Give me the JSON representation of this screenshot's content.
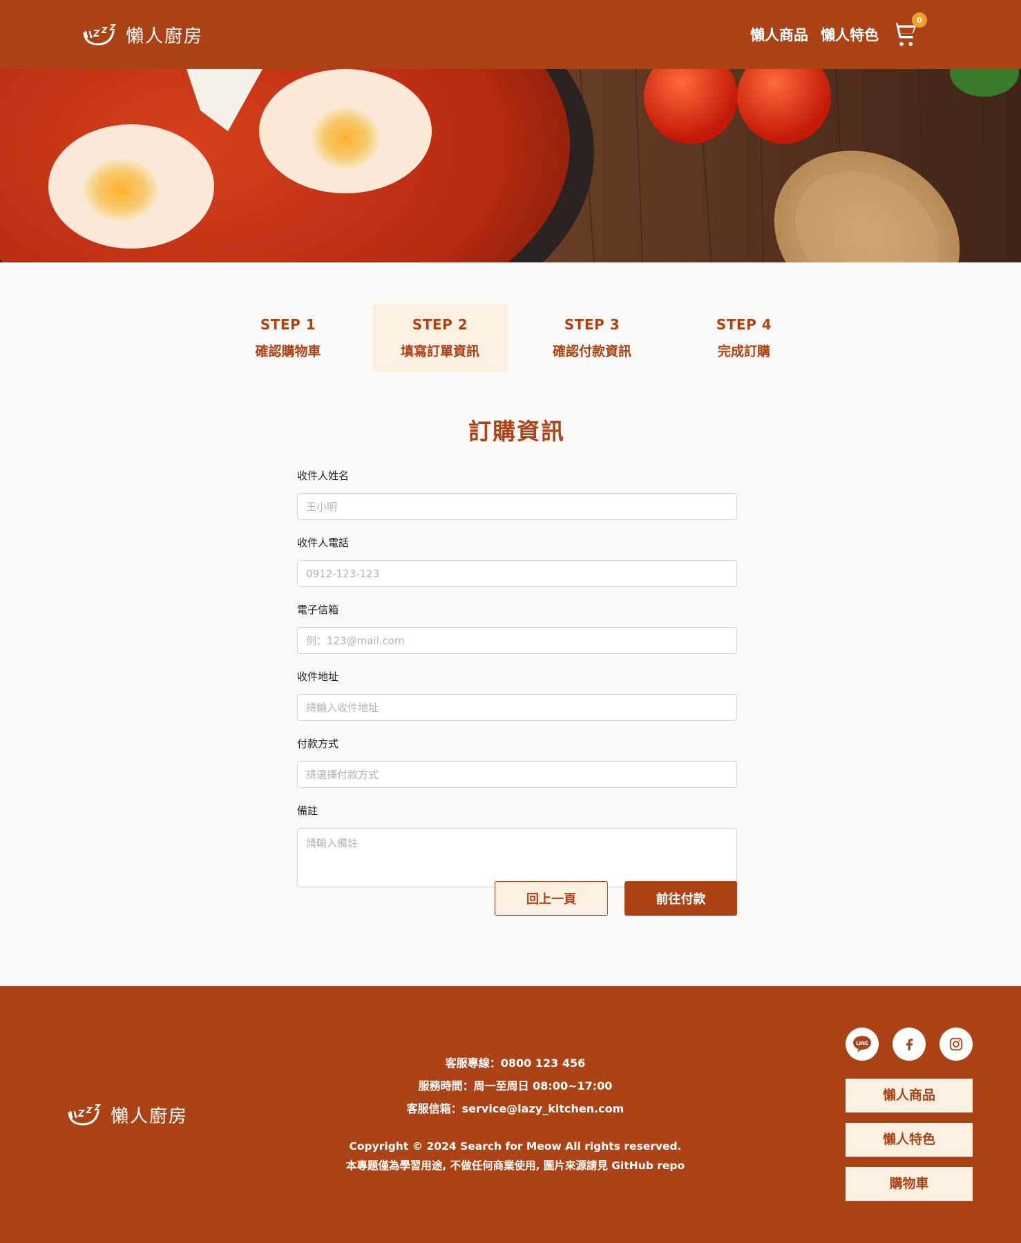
{
  "brand": {
    "name": "懶人廚房"
  },
  "nav": {
    "items": [
      "懶人商品",
      "懶人特色"
    ],
    "cart_count": "0"
  },
  "steps": [
    {
      "num": "STEP 1",
      "name": "確認購物車"
    },
    {
      "num": "STEP 2",
      "name": "填寫訂單資訊"
    },
    {
      "num": "STEP 3",
      "name": "確認付款資訊"
    },
    {
      "num": "STEP 4",
      "name": "完成訂購"
    }
  ],
  "form": {
    "title": "訂購資訊",
    "fields": [
      {
        "label": "收件人姓名",
        "placeholder": "王小明",
        "value": ""
      },
      {
        "label": "收件人電話",
        "placeholder": "0912-123-123",
        "value": ""
      },
      {
        "label": "電子信箱",
        "placeholder": "例：123@mail.com",
        "value": ""
      },
      {
        "label": "收件地址",
        "placeholder": "請輸入收件地址",
        "value": ""
      },
      {
        "label": "付款方式",
        "placeholder": "請選擇付款方式",
        "value": ""
      },
      {
        "label": "備註",
        "placeholder": "請輸入備註",
        "value": ""
      }
    ],
    "back_label": "回上一頁",
    "next_label": "前往付款"
  },
  "footer": {
    "service_phone": "客服專線：0800 123 456",
    "service_hours": "服務時間：周一至周日 08:00~17:00",
    "service_email": "客服信箱：service@lazy_kitchen.com",
    "copyright": "Copyright © 2024 Search for Meow All rights reserved.",
    "disclaimer": "本專題僅為學習用途, 不做任何商業使用, 圖片來源請見 GitHub repo",
    "social": [
      "line-icon",
      "facebook-icon",
      "instagram-icon"
    ],
    "links": [
      "懶人商品",
      "懶人特色",
      "購物車"
    ]
  },
  "colors": {
    "primary": "#ab4316",
    "accent": "#fdf0e2",
    "badge": "#f0a02a"
  }
}
